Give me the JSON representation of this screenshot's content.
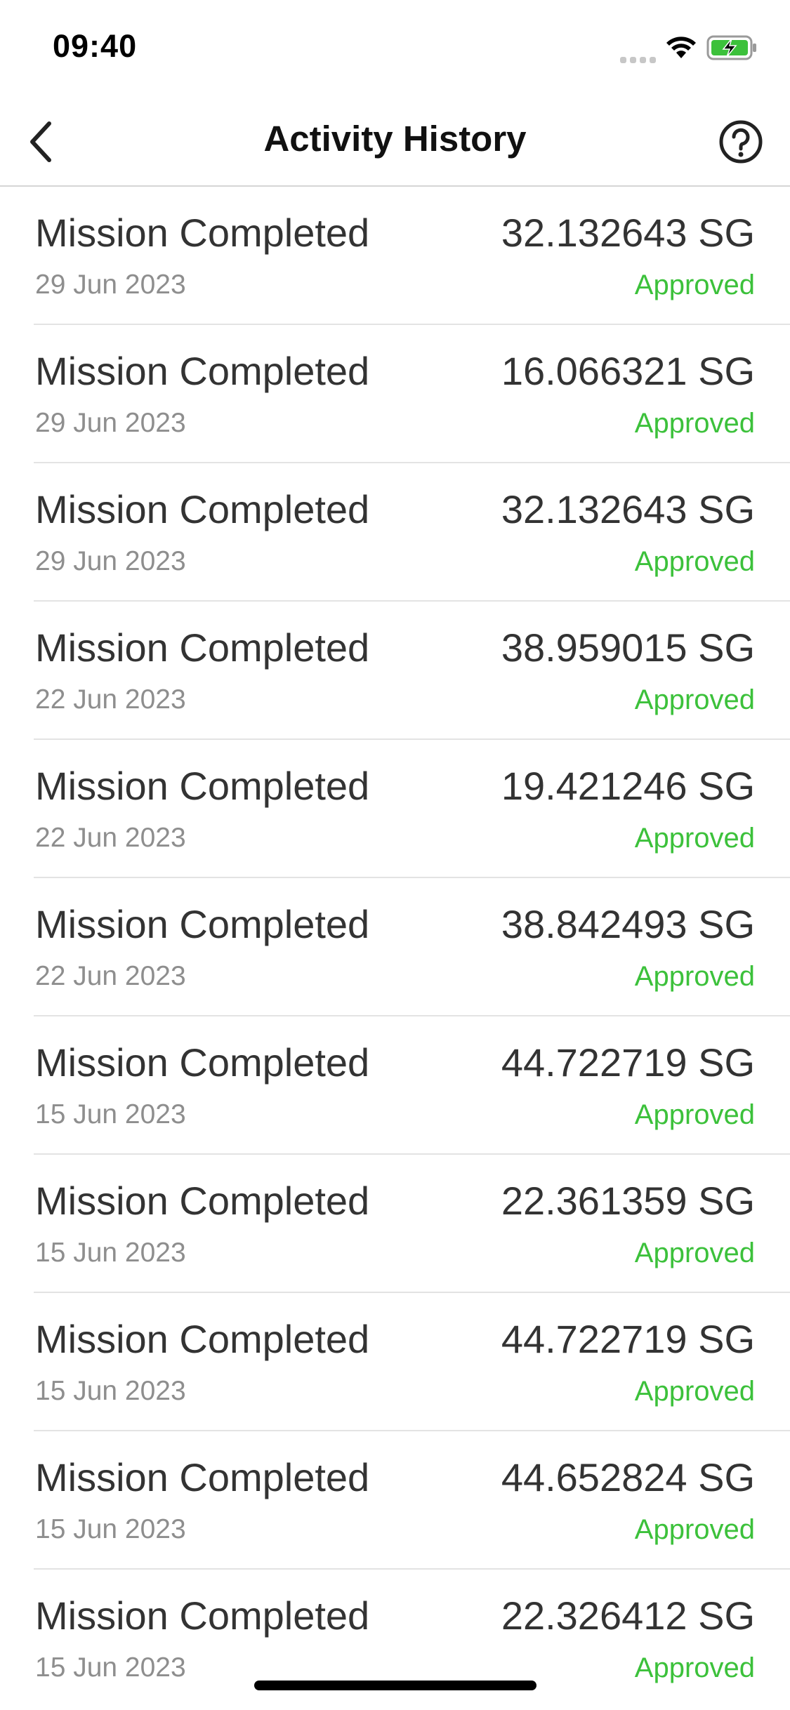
{
  "status_bar": {
    "time": "09:40",
    "icons": [
      "signal-dots-icon",
      "wifi-icon",
      "battery-charging-icon"
    ],
    "battery_color": "#3cc13b"
  },
  "nav": {
    "title": "Activity History",
    "back_icon": "chevron-left-icon",
    "help_icon": "help-circle-icon"
  },
  "colors": {
    "approved": "#3cc13b",
    "date": "#8e8e8e",
    "text": "#333333"
  },
  "items": [
    {
      "title": "Mission Completed",
      "date": "29 Jun 2023",
      "amount": "32.132643 SG",
      "status": "Approved"
    },
    {
      "title": "Mission Completed",
      "date": "29 Jun 2023",
      "amount": "16.066321 SG",
      "status": "Approved"
    },
    {
      "title": "Mission Completed",
      "date": "29 Jun 2023",
      "amount": "32.132643 SG",
      "status": "Approved"
    },
    {
      "title": "Mission Completed",
      "date": "22 Jun 2023",
      "amount": "38.959015 SG",
      "status": "Approved"
    },
    {
      "title": "Mission Completed",
      "date": "22 Jun 2023",
      "amount": "19.421246 SG",
      "status": "Approved"
    },
    {
      "title": "Mission Completed",
      "date": "22 Jun 2023",
      "amount": "38.842493 SG",
      "status": "Approved"
    },
    {
      "title": "Mission Completed",
      "date": "15 Jun 2023",
      "amount": "44.722719 SG",
      "status": "Approved"
    },
    {
      "title": "Mission Completed",
      "date": "15 Jun 2023",
      "amount": "22.361359 SG",
      "status": "Approved"
    },
    {
      "title": "Mission Completed",
      "date": "15 Jun 2023",
      "amount": "44.722719 SG",
      "status": "Approved"
    },
    {
      "title": "Mission Completed",
      "date": "15 Jun 2023",
      "amount": "44.652824 SG",
      "status": "Approved"
    },
    {
      "title": "Mission Completed",
      "date": "15 Jun 2023",
      "amount": "22.326412 SG",
      "status": "Approved"
    }
  ]
}
